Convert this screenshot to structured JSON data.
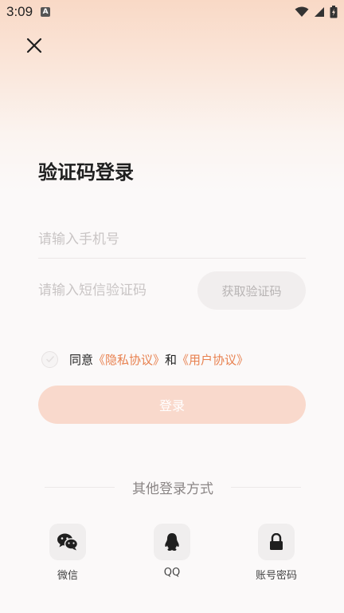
{
  "status_bar": {
    "time": "3:09",
    "indicator": "A"
  },
  "header": {
    "close_icon": "close-icon"
  },
  "page": {
    "title": "验证码登录"
  },
  "form": {
    "phone_placeholder": "请输入手机号",
    "phone_value": "",
    "code_placeholder": "请输入短信验证码",
    "code_value": "",
    "get_code_label": "获取验证码"
  },
  "agreement": {
    "checked": false,
    "prefix": "同意",
    "privacy_link": "《隐私协议》",
    "and": "和",
    "user_link": "《用户协议》"
  },
  "login_label": "登录",
  "other_login": {
    "title": "其他登录方式",
    "options": [
      {
        "label": "微信",
        "icon": "wechat-icon"
      },
      {
        "label": "QQ",
        "icon": "qq-icon"
      },
      {
        "label": "账号密码",
        "icon": "lock-icon"
      }
    ]
  },
  "colors": {
    "accent": "#e8814f",
    "login_button_disabled": "#f9d9cc",
    "title": "#1f1f1f"
  }
}
